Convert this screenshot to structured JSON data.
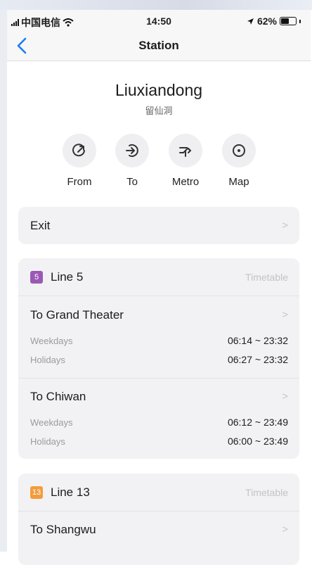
{
  "status_bar": {
    "carrier": "中国电信",
    "time": "14:50",
    "battery": "62%",
    "battery_level": 0.62
  },
  "nav": {
    "title": "Station"
  },
  "station": {
    "name": "Liuxiandong",
    "name_cn": "留仙洞"
  },
  "actions": [
    {
      "label": "From",
      "icon": "route-from-icon"
    },
    {
      "label": "To",
      "icon": "route-to-icon"
    },
    {
      "label": "Metro",
      "icon": "metro-icon"
    },
    {
      "label": "Map",
      "icon": "map-pin-icon"
    }
  ],
  "exit": {
    "label": "Exit",
    "chevron": ">"
  },
  "lines": [
    {
      "badge": "5",
      "name": "Line 5",
      "color": "#9b59b6",
      "timetable": "Timetable",
      "directions": [
        {
          "title": "To Grand Theater",
          "chevron": ">",
          "schedule": [
            {
              "label": "Weekdays",
              "time": "06:14 ~ 23:32"
            },
            {
              "label": "Holidays",
              "time": "06:27 ~ 23:32"
            }
          ]
        },
        {
          "title": "To Chiwan",
          "chevron": ">",
          "schedule": [
            {
              "label": "Weekdays",
              "time": "06:12 ~ 23:49"
            },
            {
              "label": "Holidays",
              "time": "06:00 ~ 23:49"
            }
          ]
        }
      ]
    },
    {
      "badge": "13",
      "name": "Line 13",
      "color": "#f39c3d",
      "timetable": "Timetable",
      "directions": [
        {
          "title": "To Shangwu",
          "chevron": ">"
        }
      ]
    }
  ]
}
